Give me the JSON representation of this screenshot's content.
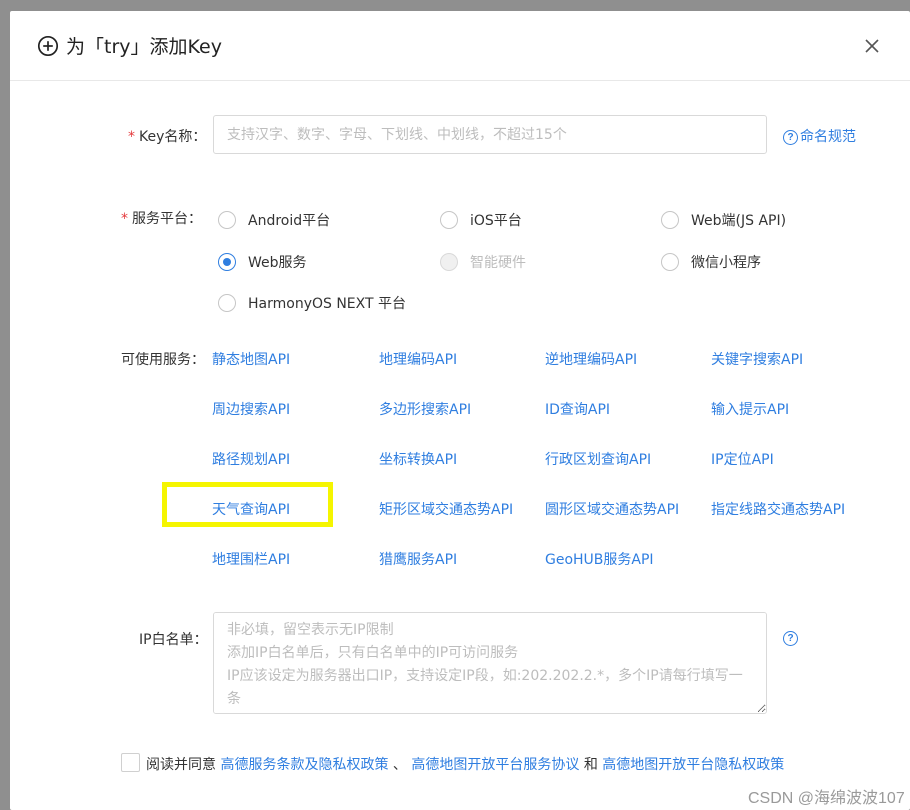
{
  "dialog": {
    "title": "为「try」添加Key",
    "close_label": "×"
  },
  "key_name": {
    "label": "Key名称：",
    "required_mark": "*",
    "placeholder": "支持汉字、数字、字母、下划线、中划线，不超过15个",
    "value": "",
    "help_link": "命名规范",
    "help_icon": "question-circle-icon"
  },
  "platform": {
    "label": "服务平台：",
    "required_mark": "*",
    "options": [
      {
        "label": "Android平台",
        "checked": false,
        "disabled": false
      },
      {
        "label": "iOS平台",
        "checked": false,
        "disabled": false
      },
      {
        "label": "Web端(JS API)",
        "checked": false,
        "disabled": false
      },
      {
        "label": "Web服务",
        "checked": true,
        "disabled": false
      },
      {
        "label": "智能硬件",
        "checked": false,
        "disabled": true
      },
      {
        "label": "微信小程序",
        "checked": false,
        "disabled": false
      },
      {
        "label": "HarmonyOS NEXT 平台",
        "checked": false,
        "disabled": false
      }
    ]
  },
  "services": {
    "label": "可使用服务：",
    "items": [
      "静态地图API",
      "地理编码API",
      "逆地理编码API",
      "关键字搜索API",
      "周边搜索API",
      "多边形搜索API",
      "ID查询API",
      "输入提示API",
      "路径规划API",
      "坐标转换API",
      "行政区划查询API",
      "IP定位API",
      "天气查询API",
      "矩形区域交通态势API",
      "圆形区域交通态势API",
      "指定线路交通态势API",
      "地理围栏API",
      "猎鹰服务API",
      "GeoHUB服务API"
    ],
    "highlighted": "天气查询API"
  },
  "ip_whitelist": {
    "label": "IP白名单：",
    "placeholder": "非必填，留空表示无IP限制\n添加IP白名单后，只有白名单中的IP可访问服务\nIP应该设定为服务器出口IP，支持设定IP段，如:202.202.2.*，多个IP请每行填写一条",
    "value": ""
  },
  "agreement": {
    "checked": false,
    "prefix": "阅读并同意",
    "link1": "高德服务条款及隐私权政策",
    "sep1": "、",
    "link2": "高德地图开放平台服务协议",
    "sep2": "和",
    "link3": "高德地图开放平台隐私权政策"
  },
  "watermark": "CSDN @海绵波波107",
  "colors": {
    "accent": "#2f7ee0",
    "required": "#e4393c",
    "highlight": "#f5f500"
  }
}
